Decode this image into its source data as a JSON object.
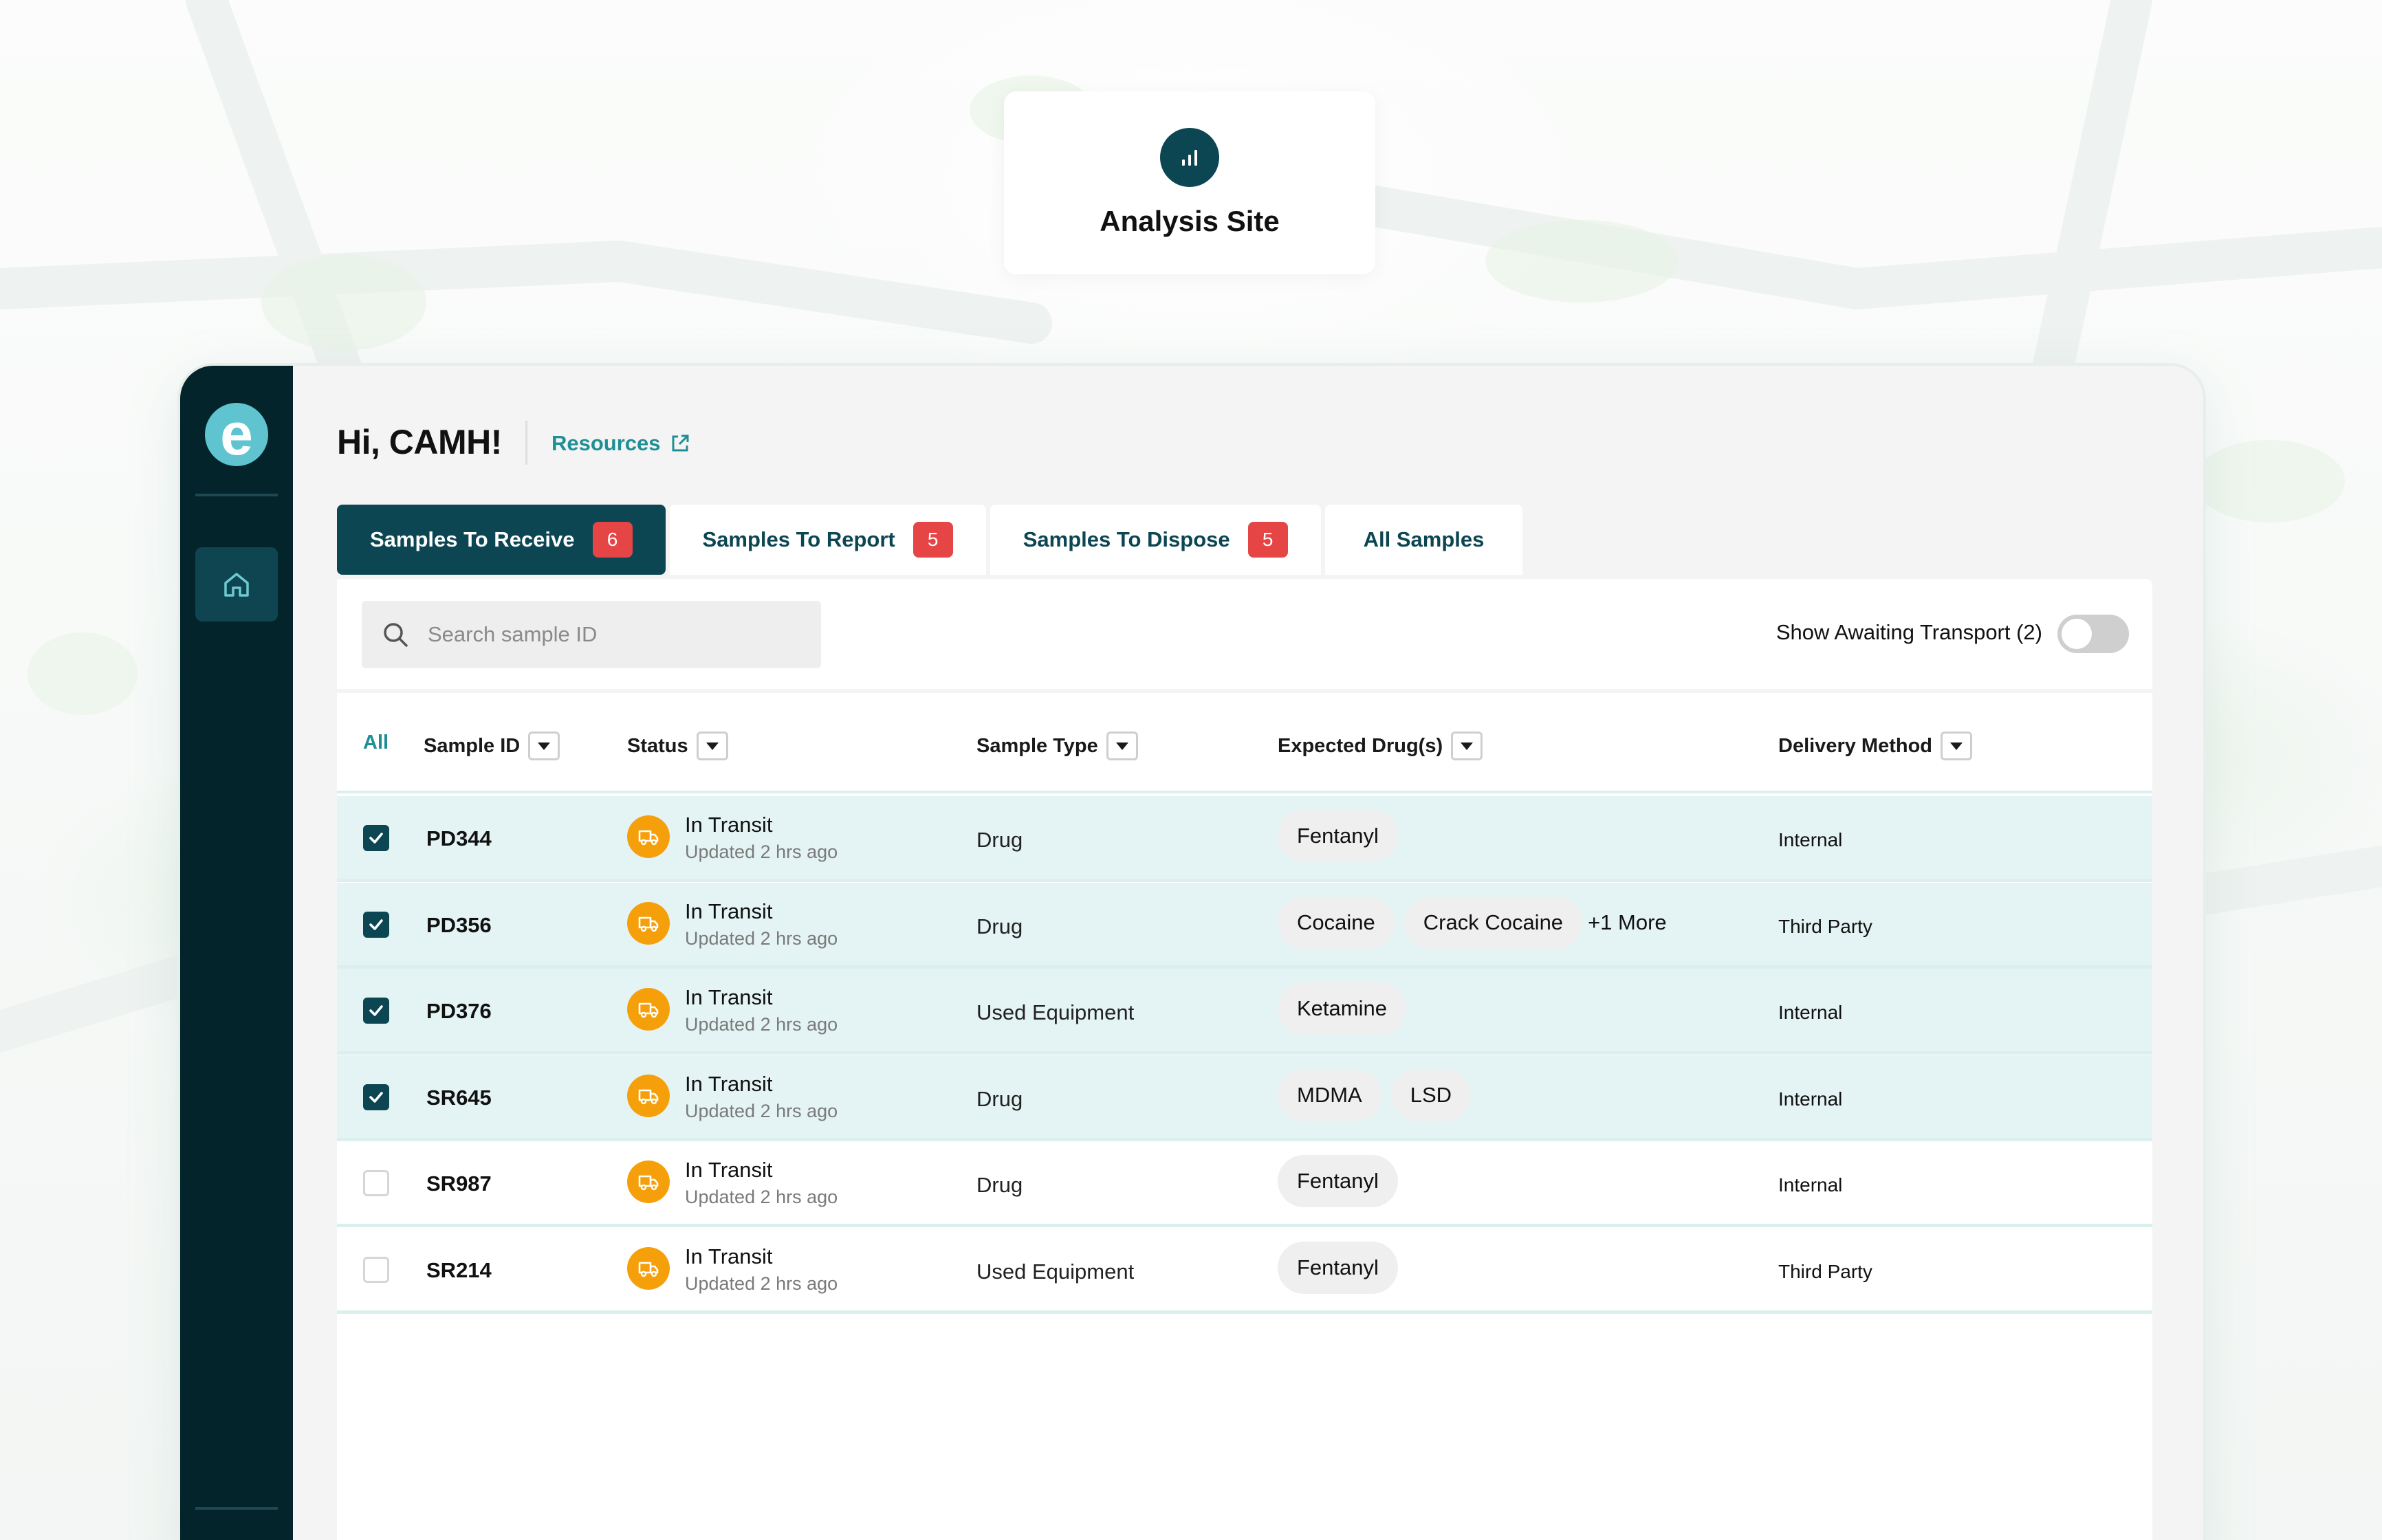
{
  "site": {
    "title": "Analysis Site",
    "icon": "bar-chart-icon"
  },
  "sidebar": {
    "logo_letter": "e",
    "items": [
      {
        "icon": "home-icon"
      }
    ]
  },
  "header": {
    "greeting": "Hi, CAMH!",
    "resources_label": "Resources"
  },
  "tabs": [
    {
      "label": "Samples To Receive",
      "badge": "6",
      "active": true
    },
    {
      "label": "Samples To Report",
      "badge": "5",
      "active": false
    },
    {
      "label": "Samples To Dispose",
      "badge": "5",
      "active": false
    },
    {
      "label": "All Samples",
      "badge": null,
      "active": false
    }
  ],
  "search": {
    "placeholder": "Search sample ID"
  },
  "awaiting": {
    "label": "Show Awaiting Transport (2)",
    "on": false
  },
  "table": {
    "columns": {
      "all": "All",
      "sample_id": "Sample ID",
      "status": "Status",
      "sample_type": "Sample Type",
      "drugs": "Expected Drug(s)",
      "delivery": "Delivery Method"
    },
    "rows": [
      {
        "id": "PD344",
        "checked": true,
        "status": "In Transit",
        "updated": "Updated 2 hrs ago",
        "type": "Drug",
        "drugs": [
          "Fentanyl"
        ],
        "more": "",
        "delivery": "Internal"
      },
      {
        "id": "PD356",
        "checked": true,
        "status": "In Transit",
        "updated": "Updated 2 hrs ago",
        "type": "Drug",
        "drugs": [
          "Cocaine",
          "Crack Cocaine"
        ],
        "more": "+1 More",
        "delivery": "Third Party"
      },
      {
        "id": "PD376",
        "checked": true,
        "status": "In Transit",
        "updated": "Updated 2 hrs ago",
        "type": "Used Equipment",
        "drugs": [
          "Ketamine"
        ],
        "more": "",
        "delivery": "Internal"
      },
      {
        "id": "SR645",
        "checked": true,
        "status": "In Transit",
        "updated": "Updated 2 hrs ago",
        "type": "Drug",
        "drugs": [
          "MDMA",
          "LSD"
        ],
        "more": "",
        "delivery": "Internal"
      },
      {
        "id": "SR987",
        "checked": false,
        "status": "In Transit",
        "updated": "Updated 2 hrs ago",
        "type": "Drug",
        "drugs": [
          "Fentanyl"
        ],
        "more": "",
        "delivery": "Internal"
      },
      {
        "id": "SR214",
        "checked": false,
        "status": "In Transit",
        "updated": "Updated 2 hrs ago",
        "type": "Used Equipment",
        "drugs": [
          "Fentanyl"
        ],
        "more": "",
        "delivery": "Third Party"
      }
    ]
  },
  "colors": {
    "sidebar": "#03242b",
    "accent": "#0b4652",
    "link": "#1f8f95",
    "badge": "#e64545",
    "transit": "#f5a00b",
    "selected_row": "#e4f3f3"
  }
}
